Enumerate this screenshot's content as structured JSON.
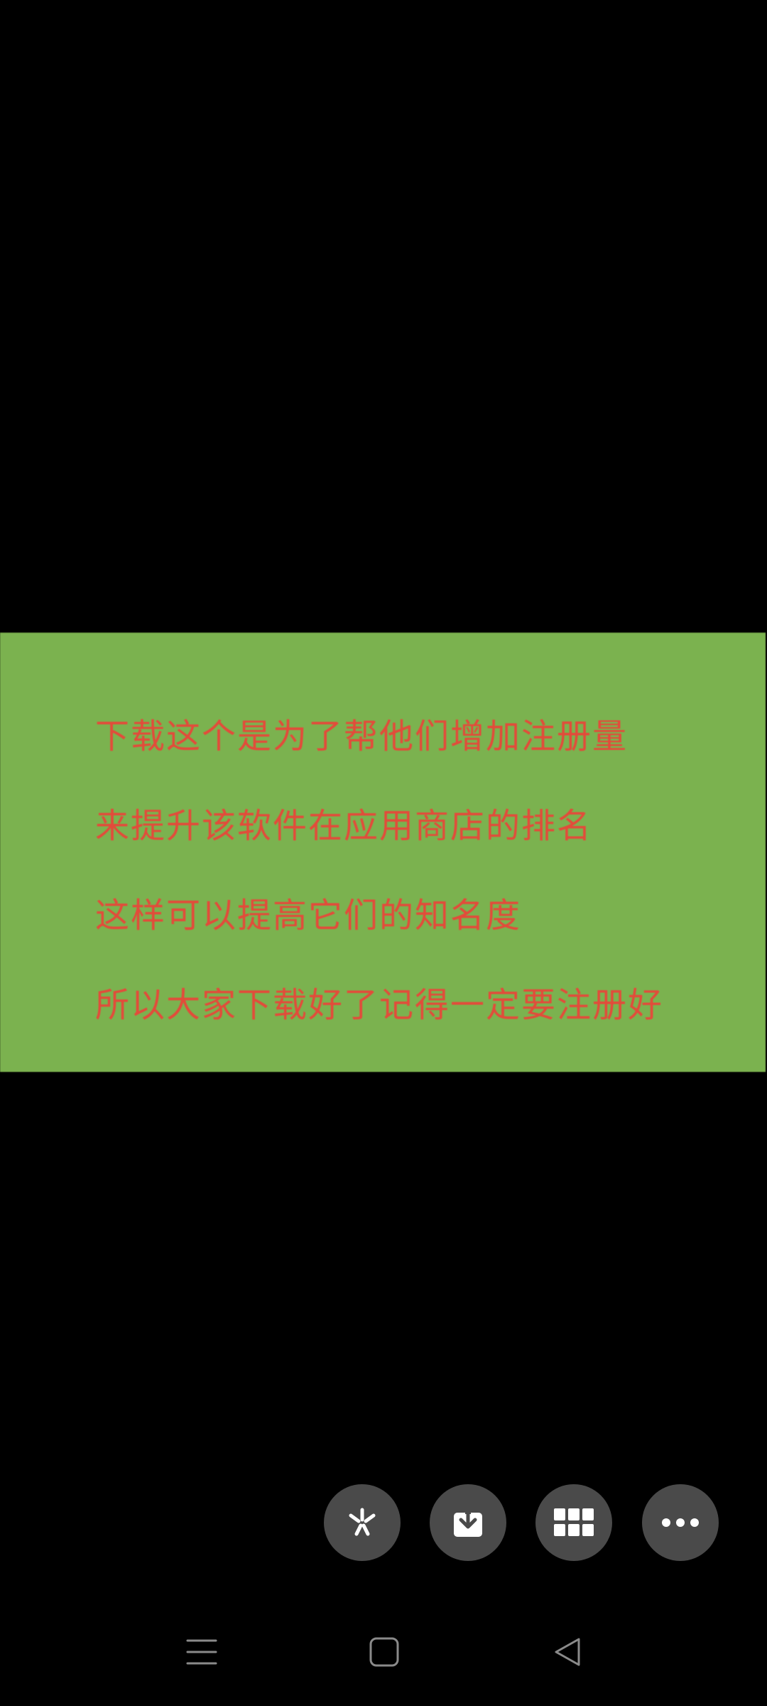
{
  "image": {
    "background": "#7bb24f",
    "text_color": "#e34b3a",
    "lines": [
      "下载这个是为了帮他们增加注册量",
      "来提升该软件在应用商店的排名",
      "这样可以提高它们的知名度",
      "所以大家下载好了记得一定要注册好"
    ]
  },
  "actions": [
    {
      "icon": "sparkle-icon"
    },
    {
      "icon": "download-icon"
    },
    {
      "icon": "grid-icon"
    },
    {
      "icon": "more-icon"
    }
  ],
  "nav": [
    {
      "icon": "menu-icon"
    },
    {
      "icon": "home-icon"
    },
    {
      "icon": "back-icon"
    }
  ]
}
